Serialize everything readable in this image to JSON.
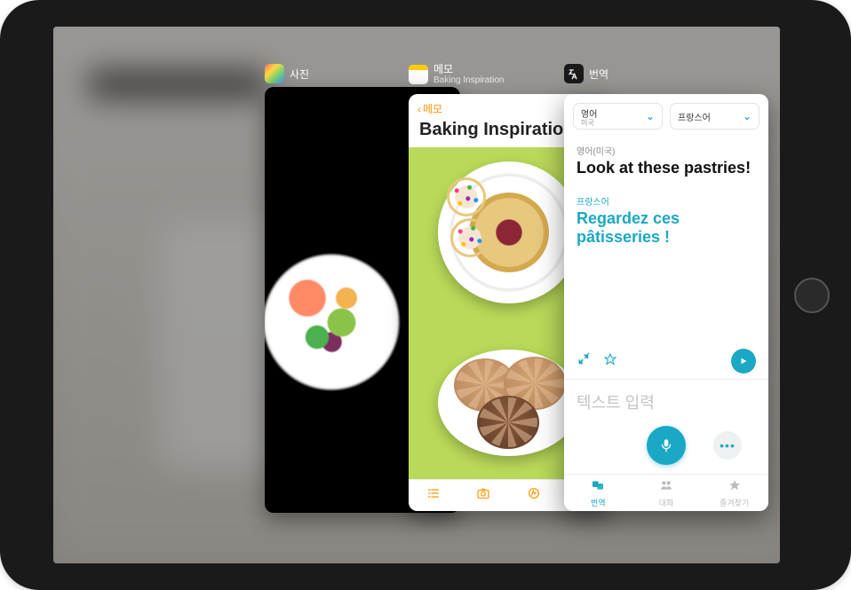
{
  "apps": {
    "photos": {
      "label": "사진"
    },
    "notes": {
      "label": "메모",
      "subtitle": "Baking Inspiration"
    },
    "translate": {
      "label": "번역"
    }
  },
  "notes": {
    "back_label": "메모",
    "title": "Baking Inspiration",
    "tabs": {
      "list": "list",
      "camera": "camera",
      "draw": "draw",
      "compose": "compose"
    }
  },
  "translate": {
    "source_lang": {
      "name": "영어",
      "region": "미국"
    },
    "target_lang": {
      "name": "프랑스어",
      "region": ""
    },
    "source_label": "영어(미국)",
    "source_text": "Look at these pastries!",
    "target_label": "프랑스어",
    "target_text": "Regardez ces pâtisseries !",
    "input_placeholder": "텍스트 입력",
    "tabs": [
      {
        "id": "translate",
        "label": "번역",
        "active": true
      },
      {
        "id": "conversation",
        "label": "대화",
        "active": false
      },
      {
        "id": "favorites",
        "label": "즐겨찾기",
        "active": false
      }
    ]
  }
}
